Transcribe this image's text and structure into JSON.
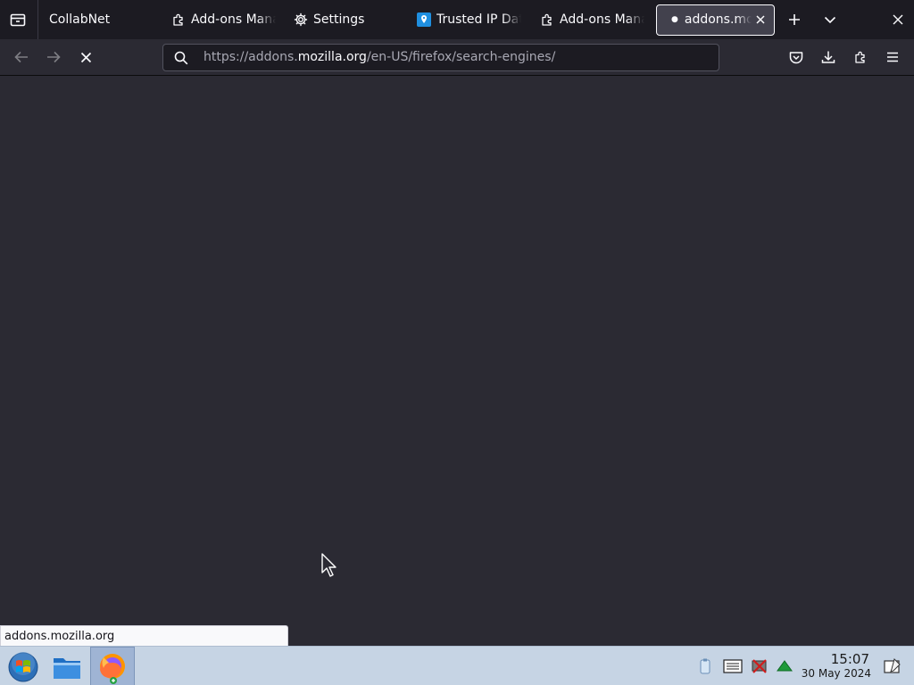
{
  "tabstrip": {
    "group_label": "CollabNet",
    "tabs": [
      {
        "label": "Add-ons Manager"
      },
      {
        "label": "Settings"
      },
      {
        "label": "Trusted IP Database"
      },
      {
        "label": "Add-ons Manager"
      },
      {
        "label": "addons.mozilla.org",
        "active": true,
        "loading": true
      }
    ]
  },
  "navbar": {
    "url_prefix": "https://addons.",
    "url_domain": "mozilla.org",
    "url_path": "/en-US/firefox/search-engines/"
  },
  "status": {
    "text": "addons.mozilla.org"
  },
  "taskbar": {
    "clock_time": "15:07",
    "clock_date": "30 May 2024"
  },
  "colors": {
    "accent_blue": "#0060df",
    "taskbar_bg": "#c6d4e4",
    "content_bg": "#2b2a33"
  }
}
